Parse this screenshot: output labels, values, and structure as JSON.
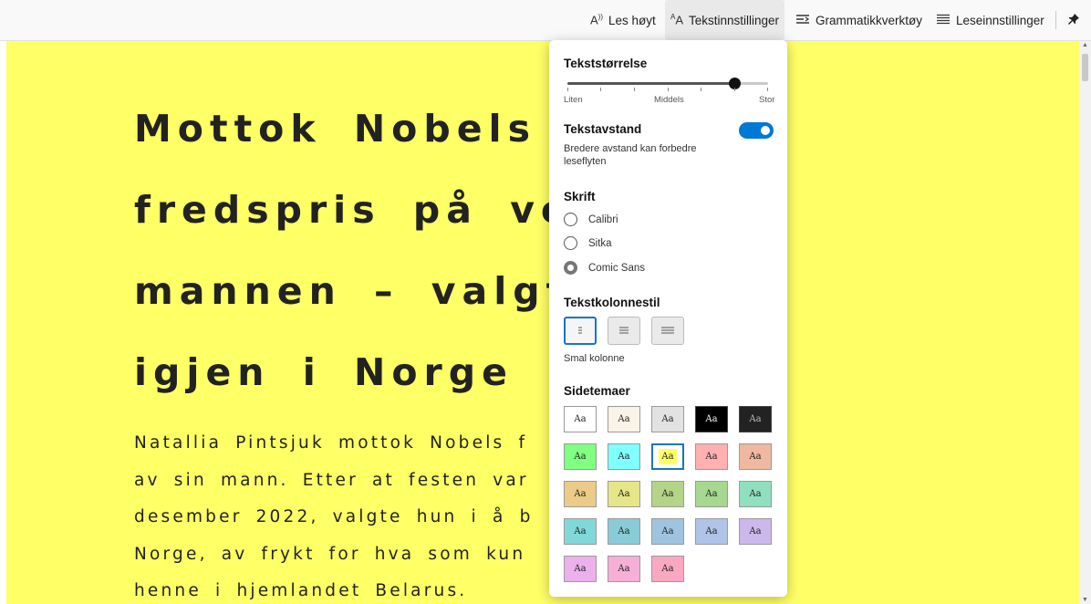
{
  "toolbar": {
    "read_aloud": "Les høyt",
    "text_settings": "Tekstinnstillinger",
    "grammar_tools": "Grammatikkverktøy",
    "reading_prefs": "Leseinnstillinger"
  },
  "article": {
    "title_lines": [
      "Mottok Nobels",
      "fredspris på ve",
      "mannen – valgte",
      "igjen i Norge"
    ],
    "body_lines": [
      "Natallia Pintsjuk mottok Nobels f",
      "av sin mann. Etter at festen var",
      "desember 2022, valgte hun i å b",
      "Norge, av frykt for hva som kun",
      "henne i hjemlandet Belarus."
    ]
  },
  "panel": {
    "text_size": {
      "title": "Tekststørrelse",
      "labels": [
        "Liten",
        "Middels",
        "Stor"
      ],
      "value_fraction": 0.83
    },
    "text_spacing": {
      "title": "Tekstavstand",
      "description": "Bredere avstand kan forbedre leseflyten",
      "enabled": true
    },
    "font": {
      "title": "Skrift",
      "options": [
        "Calibri",
        "Sitka",
        "Comic Sans"
      ],
      "selected": "Comic Sans"
    },
    "column_style": {
      "title": "Tekstkolonnestil",
      "selected_label": "Smal kolonne"
    },
    "themes": {
      "title": "Sidetemaer",
      "swatch_label": "Aa",
      "selected_color": "#ffff66",
      "colors": [
        "#ffffff",
        "#faf4e8",
        "#e2e2e2",
        "#000000",
        "#222222",
        "#80ff80",
        "#80ffff",
        "#ffff66",
        "#ffb0b0",
        "#f0b8a0",
        "#eccb88",
        "#e6e688",
        "#b4d488",
        "#a6d890",
        "#90e0c0",
        "#80d8d8",
        "#88ccd8",
        "#a0c4e0",
        "#b0c4e8",
        "#ccb8ec",
        "#ecb0ec",
        "#f6b0d8",
        "#f8a8c0"
      ]
    }
  }
}
